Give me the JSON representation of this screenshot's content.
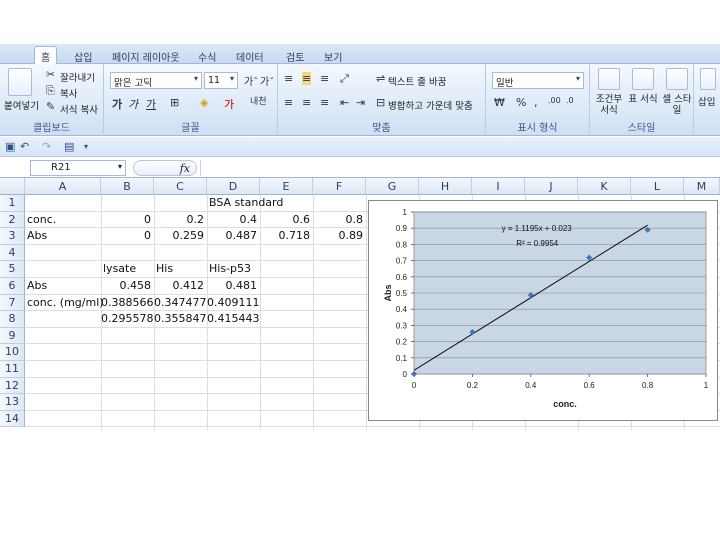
{
  "tabs": [
    "홈",
    "삽입",
    "페이지 레이아웃",
    "수식",
    "데이터",
    "검토",
    "보기"
  ],
  "ribbon": {
    "clipboard": {
      "paste": "붙여넣기",
      "cut": "잘라내기",
      "copy": "복사",
      "format_painter": "서식 복사",
      "label": "클립보드"
    },
    "font": {
      "name": "맑은 고딕",
      "size": "11",
      "label": "글꼴"
    },
    "alignment": {
      "wrap": "텍스트 줄 바꿈",
      "merge": "병합하고 가운데 맞춤",
      "label": "맞춤"
    },
    "number": {
      "format": "일반",
      "label": "표시 형식"
    },
    "styles": {
      "conditional": "조건부 서식",
      "table": "표 서식",
      "cell": "셀 스타일",
      "label": "스타일"
    },
    "cells": {
      "insert": "삽입"
    }
  },
  "formula_bar": {
    "name_box": "R21",
    "fx": "fx",
    "content": ""
  },
  "sheet": {
    "columns": [
      "A",
      "B",
      "C",
      "D",
      "E",
      "F",
      "G",
      "H",
      "I",
      "J",
      "K",
      "L",
      "M"
    ],
    "rows": [
      "1",
      "2",
      "3",
      "4",
      "5",
      "6",
      "7",
      "8",
      "9",
      "10",
      "11",
      "12",
      "13",
      "14"
    ],
    "cells": {
      "D1": "BSA standard",
      "A2": "conc.",
      "B2": "0",
      "C2": "0.2",
      "D2": "0.4",
      "E2": "0.6",
      "F2": "0.8",
      "A3": "Abs",
      "B3": "0",
      "C3": "0.259",
      "D3": "0.487",
      "E3": "0.718",
      "F3": "0.89",
      "B5": "lysate",
      "C5": "His",
      "D5": "His-p53",
      "A6": "Abs",
      "B6": "0.458",
      "C6": "0.412",
      "D6": "0.481",
      "A7": "conc. (mg/ml)",
      "B7": "0.388566",
      "C7": "0.347477",
      "D7": "0.409111",
      "B8": "0.295578",
      "C8": "0.355847",
      "D8": "0.415443"
    }
  },
  "chart_data": {
    "type": "scatter",
    "xlabel": "conc.",
    "ylabel": "Abs",
    "xlim": [
      0,
      1
    ],
    "ylim": [
      0,
      1
    ],
    "xticks": [
      "0",
      "0.2",
      "0.4",
      "0.6",
      "0.8",
      "1"
    ],
    "yticks": [
      "0",
      "0.1",
      "0.2",
      "0.3",
      "0.4",
      "0.5",
      "0.6",
      "0.7",
      "0.8",
      "0.9",
      "1"
    ],
    "x": [
      0,
      0.2,
      0.4,
      0.6,
      0.8
    ],
    "y": [
      0,
      0.259,
      0.487,
      0.718,
      0.89
    ],
    "trendline": {
      "slope": 1.1195,
      "intercept": 0.023,
      "x_range": [
        0,
        0.8
      ]
    },
    "equation": "y = 1.1195x + 0.023",
    "r2": "R² = 0.9954",
    "grid": "horizontal",
    "colors": {
      "plot_bg": "#c9d6e6",
      "marker": "#3e74b8",
      "line": "#111111"
    }
  }
}
